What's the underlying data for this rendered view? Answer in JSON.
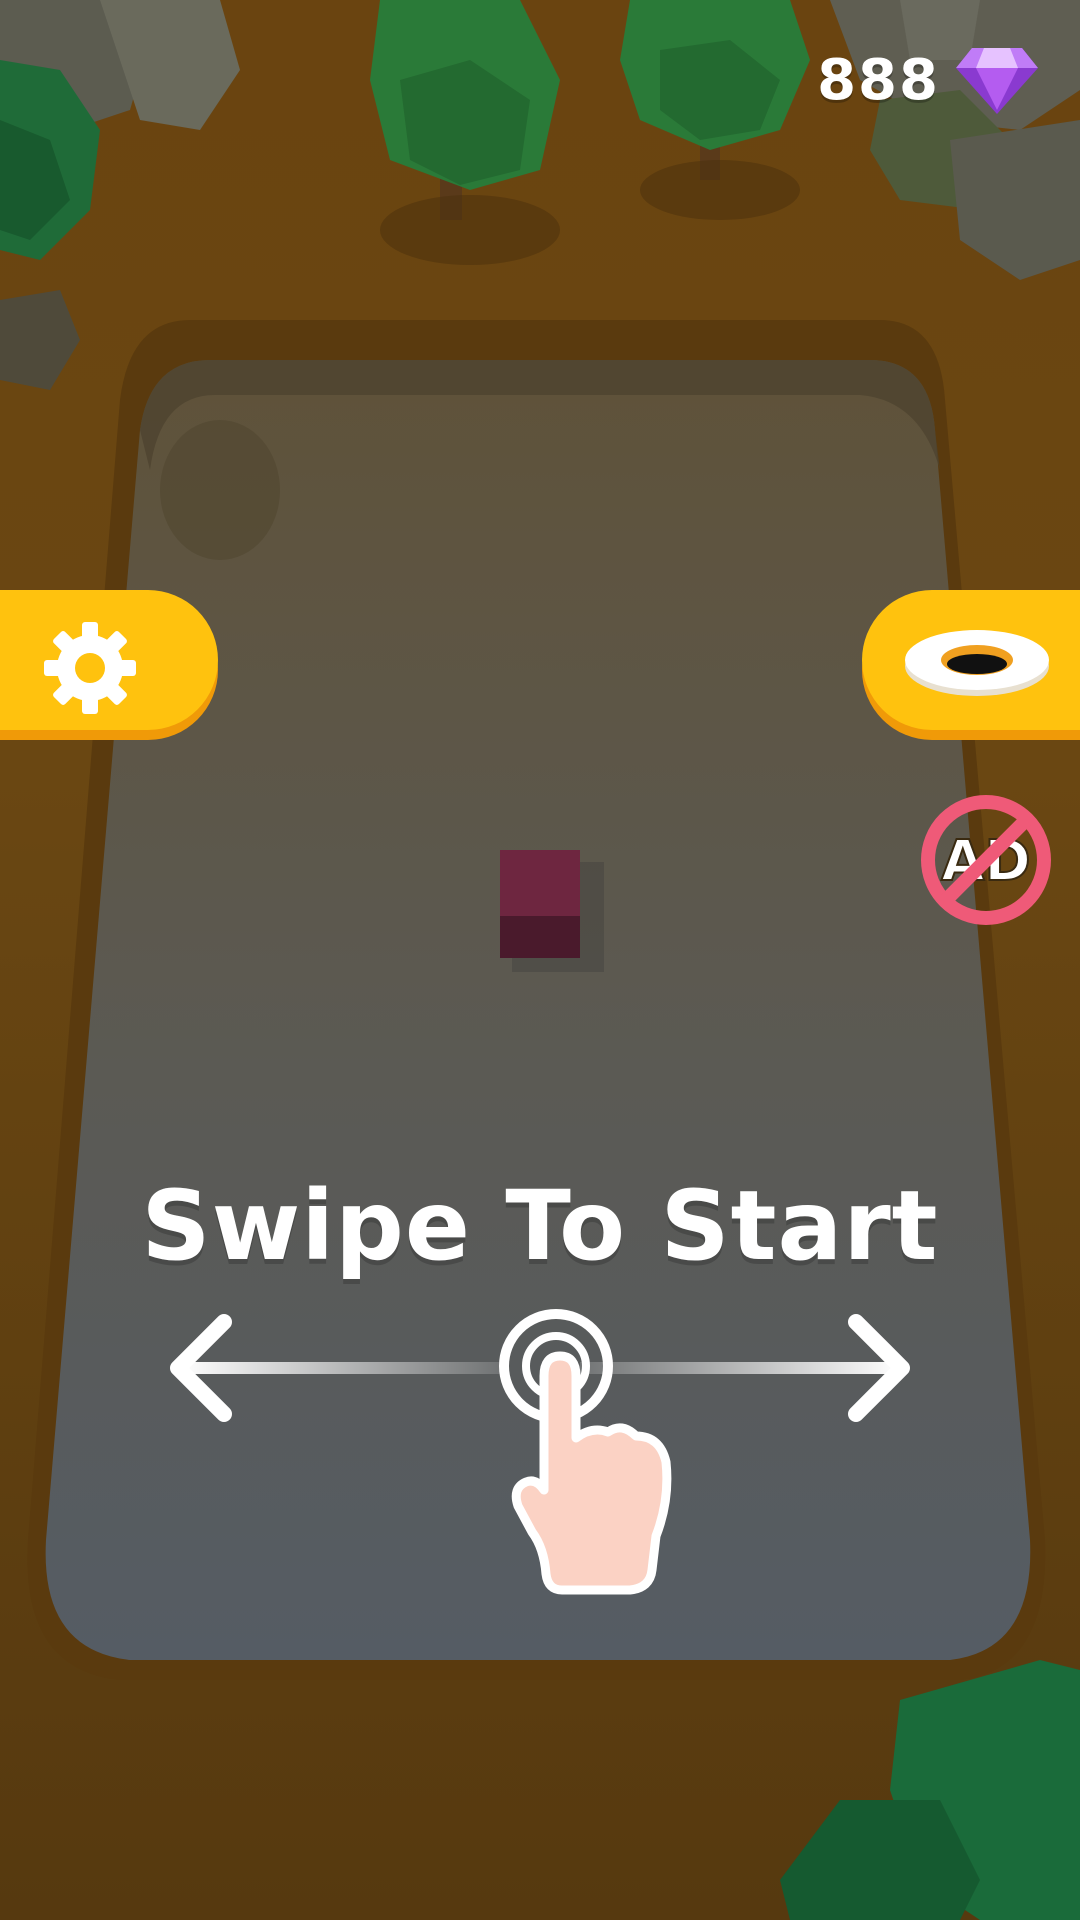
{
  "hud": {
    "gem_count": "888",
    "gem_icon": "diamond-icon"
  },
  "buttons": {
    "settings_icon": "gear-icon",
    "skins_icon": "hole-ring-icon",
    "no_ads_icon": "no-ads-icon",
    "no_ads_label": "AD"
  },
  "tutorial": {
    "prompt": "Swipe To Start",
    "left_arrow": "arrow-left-icon",
    "right_arrow": "arrow-right-icon",
    "hand": "tap-hand-icon"
  },
  "colors": {
    "accent_yellow": "#ffc20e",
    "accent_shadow": "#f09a08",
    "gem_purple": "#b45cf0",
    "no_ads_red": "#ef5a78",
    "block_maroon": "#6e2640",
    "ground": "#5e3e12"
  }
}
